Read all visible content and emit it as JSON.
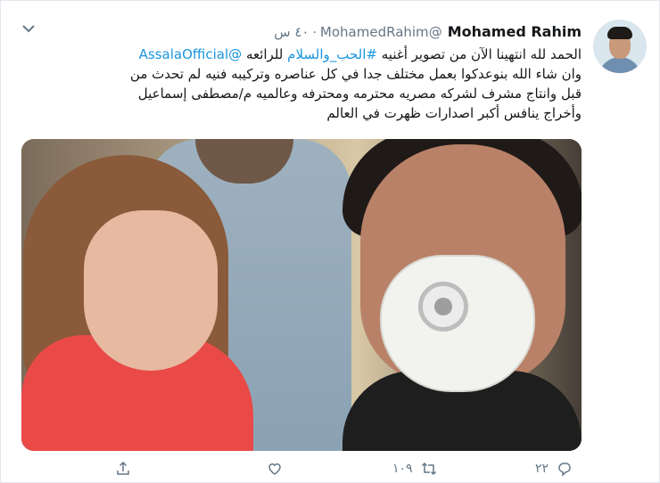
{
  "tweet": {
    "author_name": "Mohamed Rahim",
    "author_handle": "@MohamedRahim",
    "time": "٤٠ س",
    "text_lines": [
      "الحمد لله انتهينا الآن من تصوير أغنيه #الحب_والسلام للرائعه @AssalaOfficial",
      "وان شاء الله بنوعدكوا بعمل مختلف جدا في كل عناصره وتركيبه فنيه لم تحدث من",
      "قبل وانتاج مشرف لشركه مصريه محترمه ومحترفه وعالميه م/مصطفى إسماعيل",
      "وأخراج ينافس أكبر اصدارات ظهرت في العالم"
    ],
    "hashtag": "#الحب_والسلام",
    "mention": "@AssalaOfficial"
  },
  "actions": {
    "reply_count": "٢٢",
    "retweet_count": "١٠٩",
    "like_count": "",
    "share_count": ""
  },
  "icons": {
    "caret": "chevron-down-icon",
    "reply": "reply-icon",
    "retweet": "retweet-icon",
    "like": "heart-icon",
    "share": "share-icon"
  },
  "colors": {
    "link": "#1b95e0",
    "muted": "#657786",
    "text": "#14171a"
  }
}
